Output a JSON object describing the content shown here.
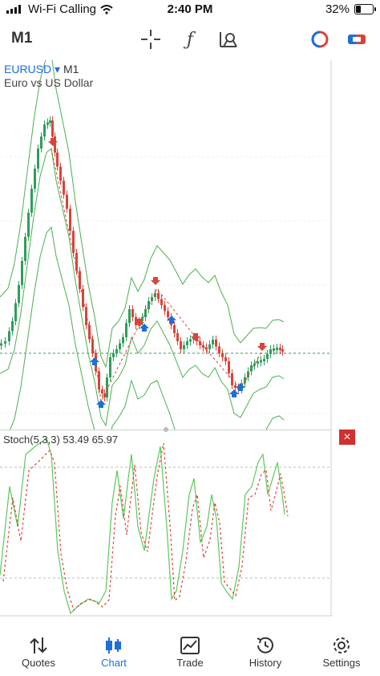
{
  "status_bar": {
    "carrier": "Wi-Fi Calling",
    "time": "2:40 PM",
    "battery": "32%"
  },
  "toolbar": {
    "timeframe": "M1",
    "icons": [
      "crosshair-icon",
      "indicator-icon",
      "objects-icon",
      "oneclick-icon",
      "trade-toggle-icon"
    ]
  },
  "chart": {
    "symbol": "EURUSD",
    "symbol_arrow": "▾",
    "timeframe": "M1",
    "description": "Euro vs US Dollar"
  },
  "indicator": {
    "label": "Stoch(5,3,3) 53.49 65.97",
    "close_icon": "×"
  },
  "nav": {
    "items": [
      {
        "label": "Quotes",
        "icon": "quotes-icon"
      },
      {
        "label": "Chart",
        "icon": "chart-icon",
        "active": true
      },
      {
        "label": "Trade",
        "icon": "trade-icon"
      },
      {
        "label": "History",
        "icon": "history-icon"
      },
      {
        "label": "Settings",
        "icon": "settings-icon"
      }
    ]
  },
  "colors": {
    "bull": "#2e9e5a",
    "bear": "#d9443a",
    "band": "#4caf50",
    "accent": "#1d6fd8",
    "signal": "#d9443a"
  }
}
